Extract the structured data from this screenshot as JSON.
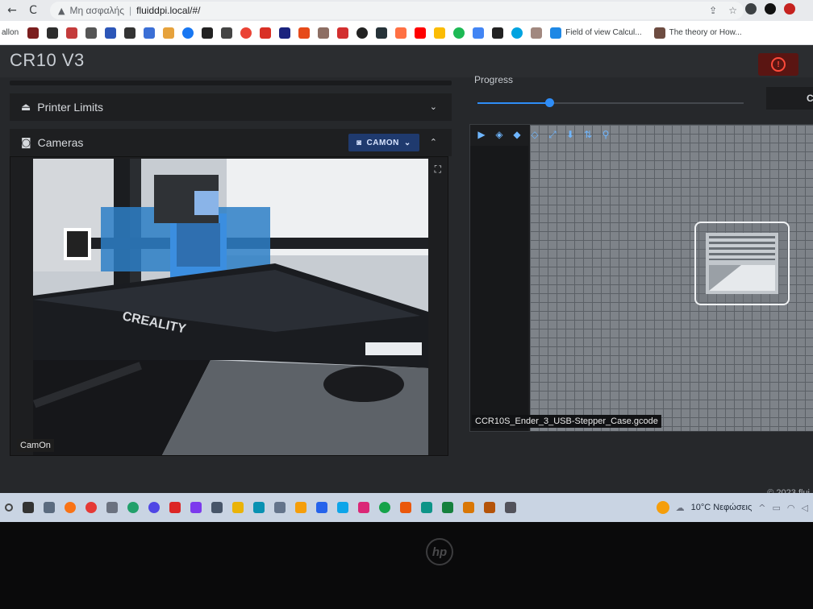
{
  "browser": {
    "back": "←",
    "reload": "C",
    "home": "⌂",
    "security_label": "Μη ασφαλής",
    "url": "fluiddpi.local/#/",
    "bookmarks_first": "allon",
    "bookmark_field_of_view": "Field of view Calcul...",
    "bookmark_theory": "The theory or How..."
  },
  "app": {
    "title": "CR10 V3"
  },
  "panels": {
    "printer_limits": "Printer Limits",
    "cameras": "Cameras",
    "camera_button": "CAMON",
    "camera_label": "CamOn"
  },
  "progress": {
    "label": "Progress",
    "fraction": 0.27,
    "right_button": "C"
  },
  "viewer": {
    "filename": "CCR10S_Ender_3_USB-Stepper_Case.gcode"
  },
  "footer": {
    "copyright": "© 2023 flui"
  },
  "taskbar": {
    "weather": "10°C Νεφώσεις"
  },
  "laptop": {
    "logo": "hp"
  },
  "colors": {
    "accent": "#2e8df7",
    "estop": "#ff4a3a",
    "camera_button": "#1f3a6e"
  }
}
